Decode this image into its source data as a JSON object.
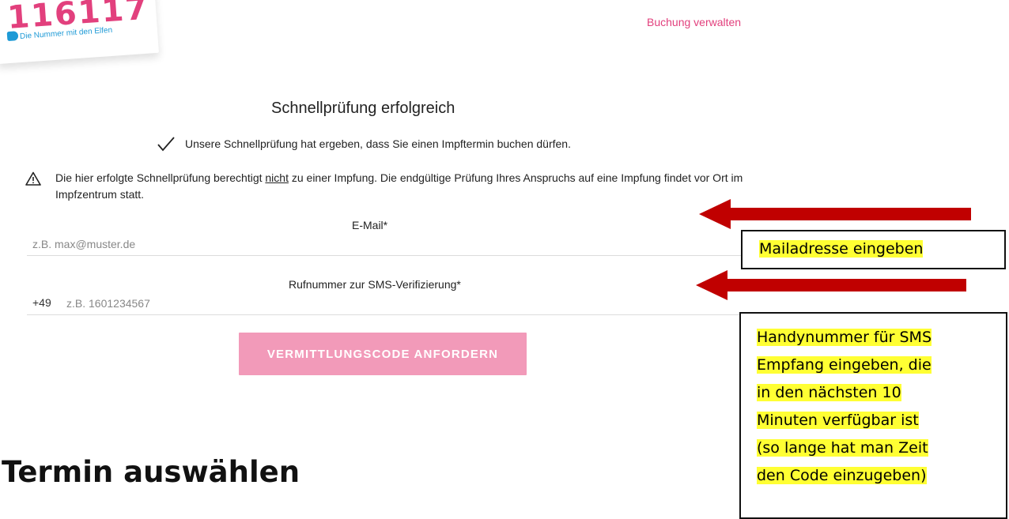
{
  "header": {
    "logo_number": "116117",
    "logo_tagline": "Die Nummer mit den Elfen",
    "manage_link": "Buchung verwalten"
  },
  "quick_check": {
    "title": "Schnellprüfung erfolgreich",
    "success_text": "Unsere Schnellprüfung hat ergeben, dass Sie einen Impftermin buchen dürfen.",
    "warning_before": "Die hier erfolgte Schnellprüfung berechtigt ",
    "warning_underlined": "nicht",
    "warning_after": " zu einer Impfung. Die endgültige Prüfung Ihres Anspruchs auf eine Impfung findet vor Ort im Impfzentrum statt."
  },
  "form": {
    "email_label": "E-Mail*",
    "email_placeholder": "z.B. max@muster.de",
    "phone_label": "Rufnummer zur SMS-Verifizierung*",
    "phone_prefix": "+49",
    "phone_placeholder": "z.B. 1601234567",
    "submit_label": "VERMITTLUNGSCODE ANFORDERN"
  },
  "next_section": {
    "heading": "Termin auswählen"
  },
  "annotations": {
    "email_callout": "Mailadresse eingeben",
    "phone_callout_lines": [
      "Handynummer für SMS",
      "Empfang eingeben, die",
      "in den nächsten 10",
      "Minuten verfügbar ist",
      "(so lange hat man Zeit",
      "den Code einzugeben)"
    ]
  },
  "colors": {
    "brand_pink": "#e2407d",
    "button_pink": "#f29ab9",
    "brand_blue": "#1e9ad6",
    "arrow_red": "#c00000",
    "highlight_yellow": "#ffff33"
  },
  "icons": {
    "success": "checkmark-icon",
    "warning": "warning-triangle-icon"
  }
}
